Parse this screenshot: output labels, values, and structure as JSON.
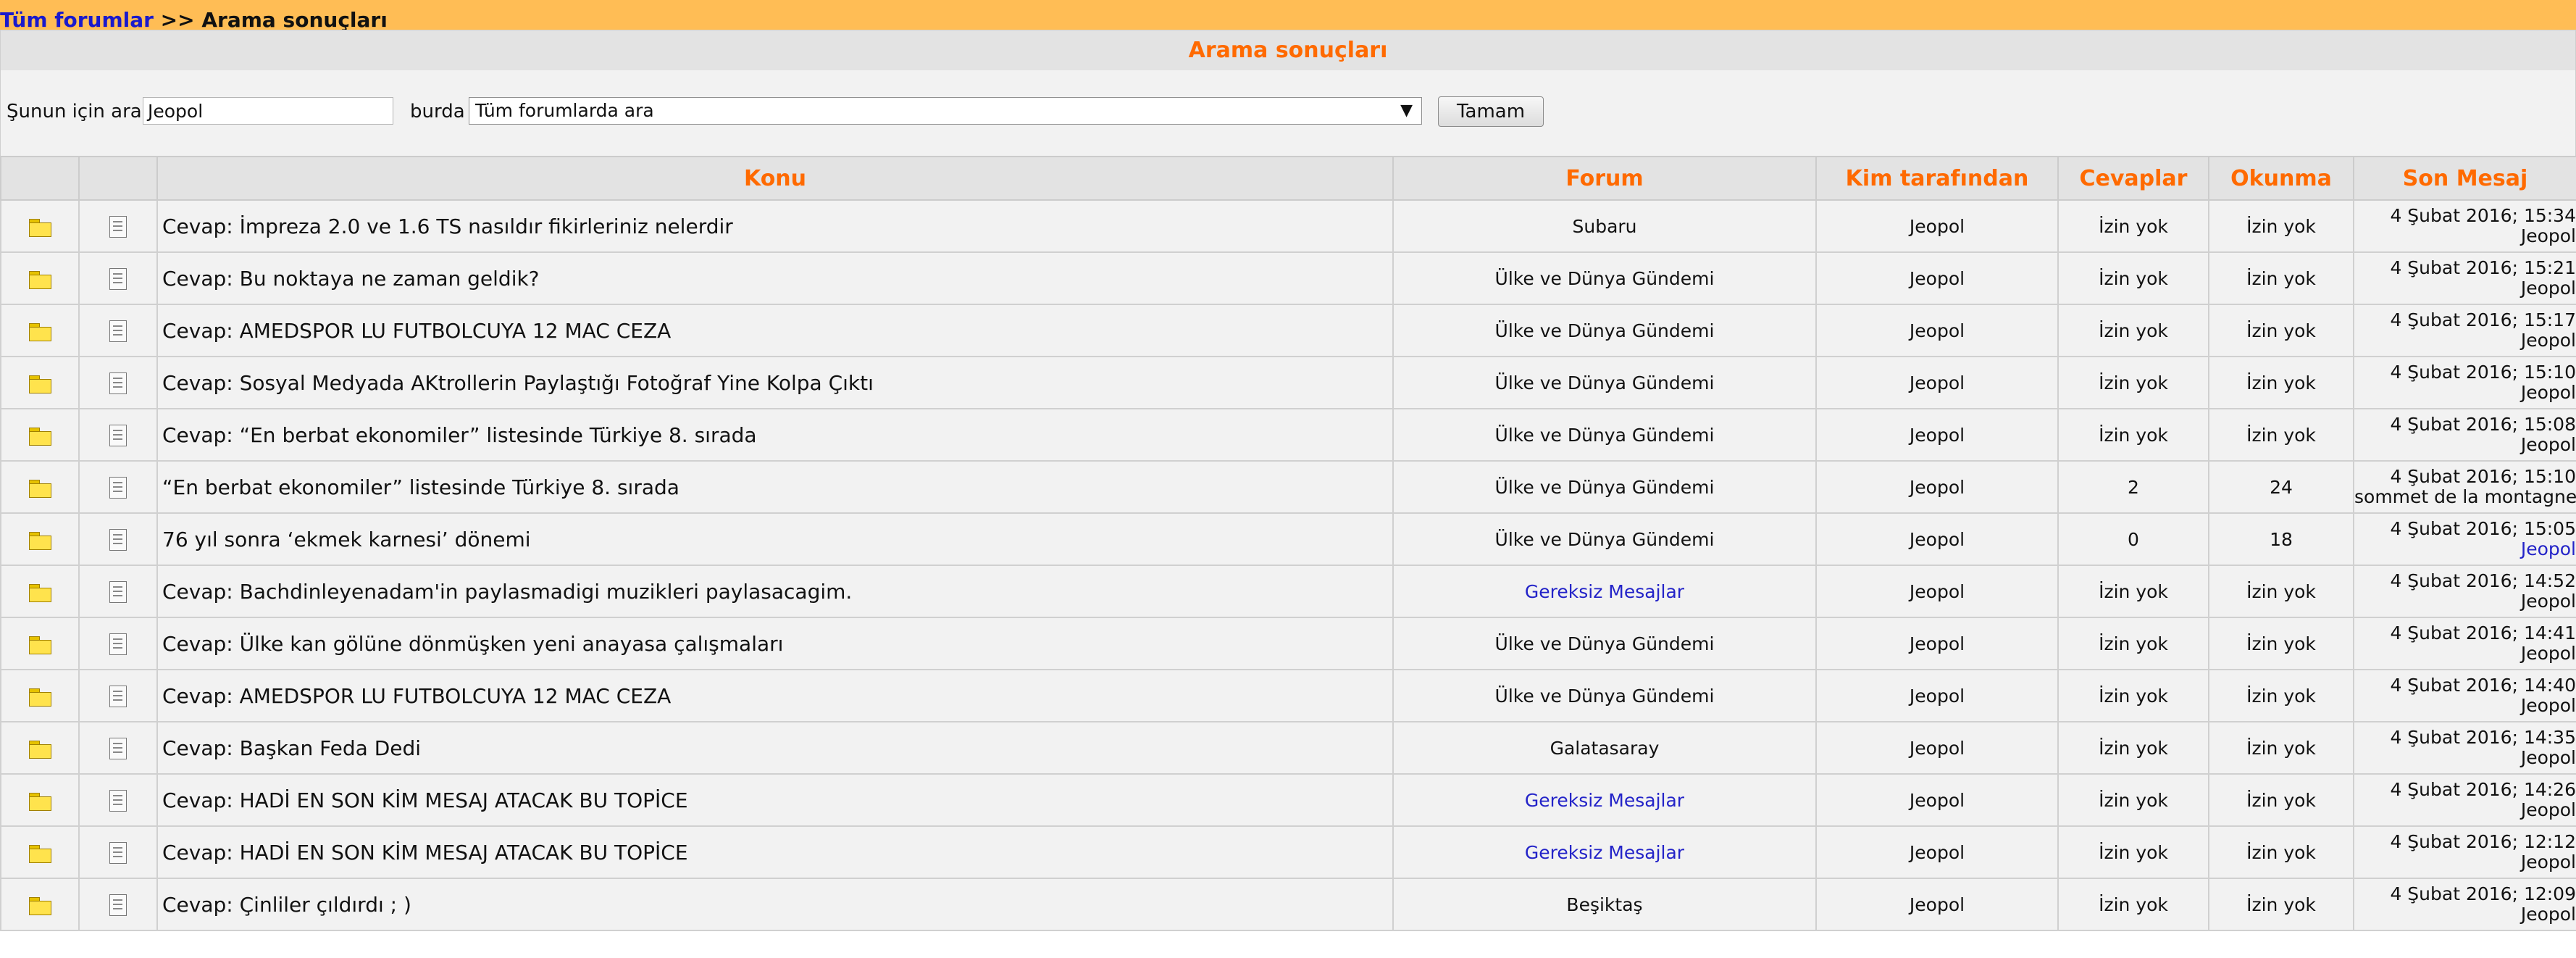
{
  "breadcrumb": {
    "all_forums": "Tüm forumlar",
    "separator": " >> ",
    "current": "Arama sonuçları"
  },
  "title": "Arama sonuçları",
  "search": {
    "label_for": "Şunun için ara",
    "query": "Jeopol",
    "label_where": "burda",
    "scope_selected": "Tüm forumlarda ara",
    "submit": "Tamam"
  },
  "icons": {
    "status": "folder-icon",
    "type": "document-icon"
  },
  "columns": [
    "Konu",
    "Forum",
    "Kim tarafından",
    "Cevaplar",
    "Okunma",
    "Son Mesaj"
  ],
  "rows": [
    {
      "topic": "Cevap: İmpreza 2.0 ve 1.6 TS nasıldır fikirleriniz nelerdir",
      "forum": "Subaru",
      "forum_link": false,
      "author": "Jeopol",
      "replies": "İzin yok",
      "views": "İzin yok",
      "last_date": "4 Şubat 2016; 15:34",
      "last_user": "Jeopol",
      "last_user_link": false
    },
    {
      "topic": "Cevap: Bu noktaya ne zaman geldik?",
      "forum": "Ülke ve Dünya Gündemi",
      "forum_link": false,
      "author": "Jeopol",
      "replies": "İzin yok",
      "views": "İzin yok",
      "last_date": "4 Şubat 2016; 15:21",
      "last_user": "Jeopol",
      "last_user_link": false
    },
    {
      "topic": "Cevap: AMEDSPOR LU FUTBOLCUYA 12 MAC CEZA",
      "forum": "Ülke ve Dünya Gündemi",
      "forum_link": false,
      "author": "Jeopol",
      "replies": "İzin yok",
      "views": "İzin yok",
      "last_date": "4 Şubat 2016; 15:17",
      "last_user": "Jeopol",
      "last_user_link": false
    },
    {
      "topic": "Cevap: Sosyal Medyada AKtrollerin Paylaştığı Fotoğraf Yine Kolpa Çıktı",
      "forum": "Ülke ve Dünya Gündemi",
      "forum_link": false,
      "author": "Jeopol",
      "replies": "İzin yok",
      "views": "İzin yok",
      "last_date": "4 Şubat 2016; 15:10",
      "last_user": "Jeopol",
      "last_user_link": false
    },
    {
      "topic": "Cevap: “En berbat ekonomiler” listesinde Türkiye 8. sırada",
      "forum": "Ülke ve Dünya Gündemi",
      "forum_link": false,
      "author": "Jeopol",
      "replies": "İzin yok",
      "views": "İzin yok",
      "last_date": "4 Şubat 2016; 15:08",
      "last_user": "Jeopol",
      "last_user_link": false
    },
    {
      "topic": "“En berbat ekonomiler” listesinde Türkiye 8. sırada",
      "forum": "Ülke ve Dünya Gündemi",
      "forum_link": false,
      "author": "Jeopol",
      "replies": "2",
      "views": "24",
      "last_date": "4 Şubat 2016; 15:10",
      "last_user": "sommet de la montagne",
      "last_user_link": false
    },
    {
      "topic": "76 yıl sonra ‘ekmek karnesi’ dönemi",
      "forum": "Ülke ve Dünya Gündemi",
      "forum_link": false,
      "author": "Jeopol",
      "replies": "0",
      "views": "18",
      "last_date": "4 Şubat 2016; 15:05",
      "last_user": "Jeopol",
      "last_user_link": true
    },
    {
      "topic": "Cevap: Bachdinleyenadam'in paylasmadigi muzikleri paylasacagim.",
      "forum": "Gereksiz Mesajlar",
      "forum_link": true,
      "author": "Jeopol",
      "replies": "İzin yok",
      "views": "İzin yok",
      "last_date": "4 Şubat 2016; 14:52",
      "last_user": "Jeopol",
      "last_user_link": false
    },
    {
      "topic": "Cevap: Ülke kan gölüne dönmüşken yeni anayasa çalışmaları",
      "forum": "Ülke ve Dünya Gündemi",
      "forum_link": false,
      "author": "Jeopol",
      "replies": "İzin yok",
      "views": "İzin yok",
      "last_date": "4 Şubat 2016; 14:41",
      "last_user": "Jeopol",
      "last_user_link": false
    },
    {
      "topic": "Cevap: AMEDSPOR LU FUTBOLCUYA 12 MAC CEZA",
      "forum": "Ülke ve Dünya Gündemi",
      "forum_link": false,
      "author": "Jeopol",
      "replies": "İzin yok",
      "views": "İzin yok",
      "last_date": "4 Şubat 2016; 14:40",
      "last_user": "Jeopol",
      "last_user_link": false
    },
    {
      "topic": "Cevap: Başkan Feda Dedi",
      "forum": "Galatasaray",
      "forum_link": false,
      "author": "Jeopol",
      "replies": "İzin yok",
      "views": "İzin yok",
      "last_date": "4 Şubat 2016; 14:35",
      "last_user": "Jeopol",
      "last_user_link": false
    },
    {
      "topic": "Cevap: HADİ EN SON KİM MESAJ ATACAK BU TOPİCE",
      "forum": "Gereksiz Mesajlar",
      "forum_link": true,
      "author": "Jeopol",
      "replies": "İzin yok",
      "views": "İzin yok",
      "last_date": "4 Şubat 2016; 14:26",
      "last_user": "Jeopol",
      "last_user_link": false
    },
    {
      "topic": "Cevap: HADİ EN SON KİM MESAJ ATACAK BU TOPİCE",
      "forum": "Gereksiz Mesajlar",
      "forum_link": true,
      "author": "Jeopol",
      "replies": "İzin yok",
      "views": "İzin yok",
      "last_date": "4 Şubat 2016; 12:12",
      "last_user": "Jeopol",
      "last_user_link": false
    },
    {
      "topic": "Cevap: Çinliler çıldırdı ; )",
      "forum": "Beşiktaş",
      "forum_link": false,
      "author": "Jeopol",
      "replies": "İzin yok",
      "views": "İzin yok",
      "last_date": "4 Şubat 2016; 12:09",
      "last_user": "Jeopol",
      "last_user_link": false
    }
  ],
  "colors": {
    "header_bar": "#ffbd55",
    "accent": "#ff6a00",
    "link": "#2323c8"
  }
}
